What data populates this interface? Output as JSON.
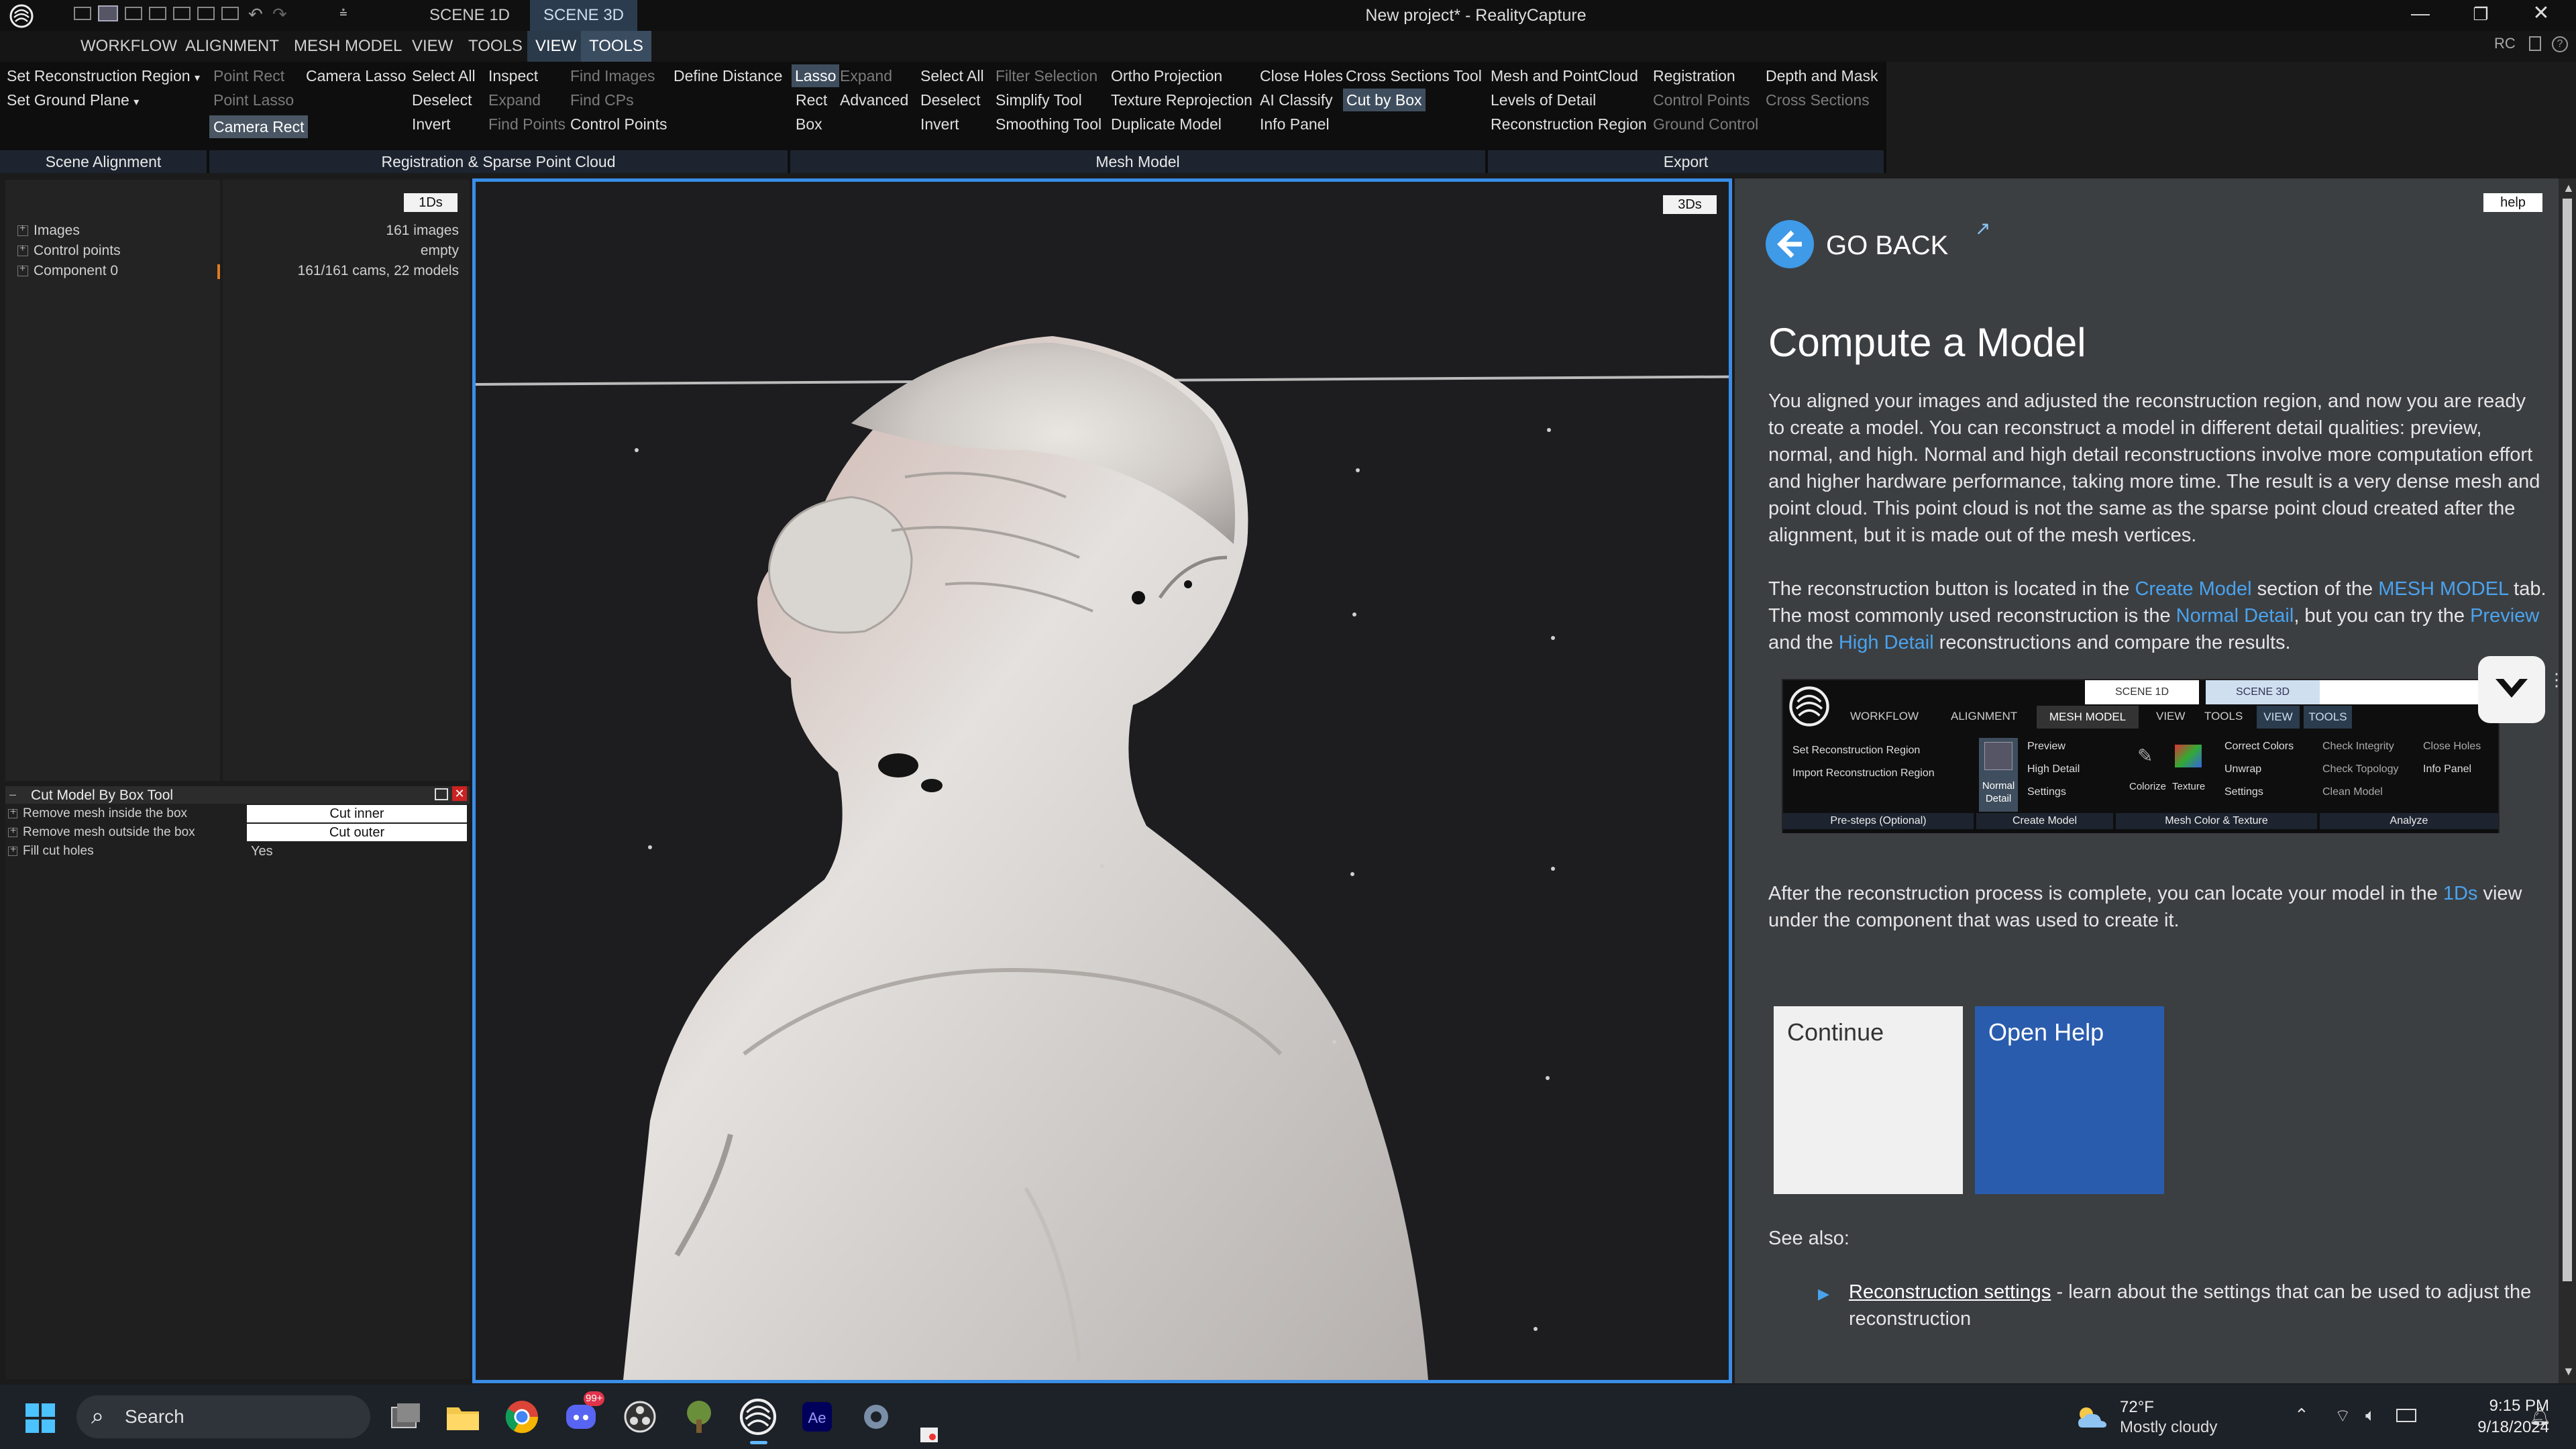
{
  "window": {
    "title": "New project* - RealityCapture",
    "scene_tabs": [
      "SCENE 1D",
      "SCENE 3D"
    ],
    "rc_label": "RC"
  },
  "menu": [
    "WORKFLOW",
    "ALIGNMENT",
    "MESH MODEL",
    "VIEW",
    "TOOLS",
    "VIEW",
    "TOOLS"
  ],
  "ribbon": {
    "col1": [
      "Set Reconstruction Region",
      "Set Ground Plane"
    ],
    "col2": [
      "Point Rect",
      "Point Lasso",
      "Camera Rect"
    ],
    "col3": [
      "Camera Lasso"
    ],
    "col4": [
      "Select All",
      "Deselect",
      "Invert"
    ],
    "col5": [
      "Inspect",
      "Expand",
      "Find Points"
    ],
    "col6": [
      "Find Images",
      "Find CPs",
      "Control Points"
    ],
    "col7": [
      "Define Distance"
    ],
    "col8": [
      "Lasso",
      "Rect",
      "Box"
    ],
    "col9": [
      "Expand",
      "Advanced"
    ],
    "col10": [
      "Select All",
      "Deselect",
      "Invert"
    ],
    "col11": [
      "Filter Selection",
      "Simplify Tool",
      "Smoothing Tool"
    ],
    "col12": [
      "Ortho Projection",
      "Texture Reprojection",
      "Duplicate Model"
    ],
    "col13": [
      "Close Holes",
      "AI Classify",
      "Info Panel"
    ],
    "col14": [
      "Cross Sections Tool",
      "Cut by Box"
    ],
    "col15": [
      "Mesh and PointCloud",
      "Levels of Detail",
      "Reconstruction Region"
    ],
    "col16": [
      "Registration",
      "Control Points",
      "Ground Control"
    ],
    "col17": [
      "Depth and Mask",
      "Cross Sections"
    ],
    "groups": [
      "Scene Alignment",
      "Registration & Sparse Point Cloud",
      "Mesh Model",
      "Export"
    ]
  },
  "tree": {
    "badge": "1Ds",
    "rows": [
      {
        "label": "Images",
        "value": "161 images"
      },
      {
        "label": "Control points",
        "value": "empty"
      },
      {
        "label": "Component 0",
        "value": "161/161 cams, 22 models"
      }
    ]
  },
  "tool": {
    "title": "Cut Model By Box Tool",
    "rows": [
      {
        "label": "Remove mesh inside the box",
        "value": "Cut inner"
      },
      {
        "label": "Remove mesh outside the box",
        "value": "Cut outer"
      },
      {
        "label": "Fill cut holes",
        "value": "Yes"
      }
    ]
  },
  "viewport": {
    "badge": "3Ds"
  },
  "help": {
    "help_button": "help",
    "go_back": "GO BACK",
    "heading": "Compute a Model",
    "para1": "You aligned your images and adjusted the reconstruction region, and now you are ready to create a model. You can reconstruct a model in different detail qualities: preview, normal, and high. Normal and high detail reconstructions involve more computation effort and higher hardware performance, taking more time. The result is a very dense mesh and point cloud. This point cloud is not the same as the sparse point cloud created after the alignment, but it is made out of the mesh vertices.",
    "p2_a": "The reconstruction button is located in the ",
    "p2_link1": "Create Model",
    "p2_b": " section of the ",
    "p2_link2": "MESH MODEL",
    "p2_c": " tab. The most commonly used reconstruction is the ",
    "p2_link3": "Normal Detail",
    "p2_d": ", but you can try the ",
    "p2_link4": "Preview",
    "p2_e": " and the ",
    "p2_link5": "High Detail",
    "p2_f": " reconstructions and compare the results.",
    "p3_a": "After the reconstruction process is complete, you can locate your model in the ",
    "p3_link": "1Ds",
    "p3_b": " view under the component that was used to create it.",
    "continue": "Continue",
    "open_help": "Open Help",
    "see_also": "See also:",
    "see_link": "Reconstruction settings",
    "see_text": " - learn about the settings that can be used to adjust the reconstruction"
  },
  "embed": {
    "tabs": [
      "SCENE 1D",
      "SCENE 3D"
    ],
    "menu": [
      "WORKFLOW",
      "ALIGNMENT",
      "MESH MODEL",
      "VIEW",
      "TOOLS",
      "VIEW",
      "TOOLS"
    ],
    "pre_items": [
      "Set Reconstruction Region",
      "Import Reconstruction Region"
    ],
    "normal": "Normal Detail",
    "create_items": [
      "Preview",
      "High Detail",
      "Settings"
    ],
    "colorize": "Colorize",
    "texture": "Texture",
    "color_items": [
      "Correct Colors",
      "Unwrap",
      "Settings"
    ],
    "analyze1": [
      "Check Integrity",
      "Check Topology",
      "Clean Model"
    ],
    "analyze2": [
      "Close Holes",
      "Info Panel"
    ],
    "groups": [
      "Pre-steps (Optional)",
      "Create Model",
      "Mesh Color & Texture",
      "Analyze"
    ]
  },
  "taskbar": {
    "search": "Search",
    "badge": "99+",
    "weather_temp": "72°F",
    "weather_desc": "Mostly cloudy",
    "time": "9:15 PM",
    "date": "9/18/2024"
  }
}
